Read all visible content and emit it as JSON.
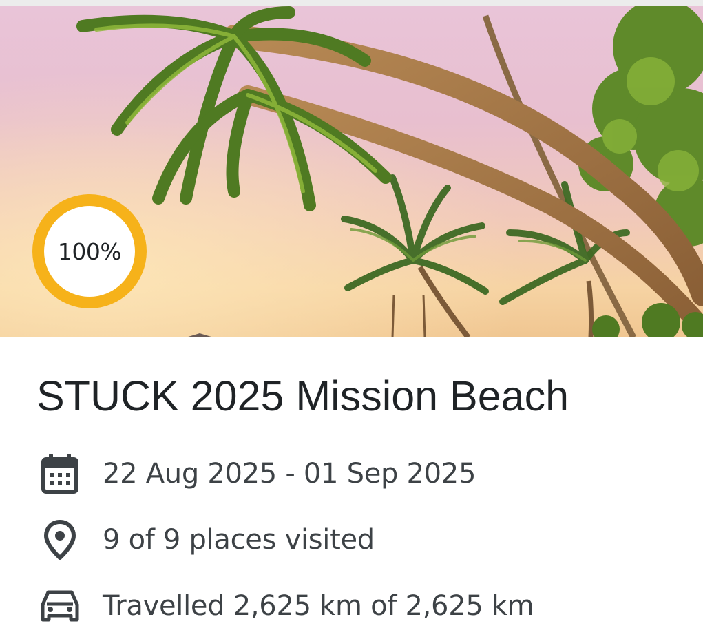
{
  "trip": {
    "cover_image": "tropical-beach-palm-trees-sunset",
    "progress_label": "100%",
    "title": "STUCK 2025 Mission Beach",
    "details": {
      "dates": "22 Aug 2025 - 01 Sep 2025",
      "places": "9 of 9 places visited",
      "distance": "Travelled 2,625 km of 2,625 km"
    },
    "icons": {
      "dates": "calendar-icon",
      "places": "location-pin-icon",
      "distance": "car-icon"
    },
    "colors": {
      "progress_ring": "#f6b21a",
      "text_primary": "#1f2326",
      "text_secondary": "#3d4246"
    }
  }
}
